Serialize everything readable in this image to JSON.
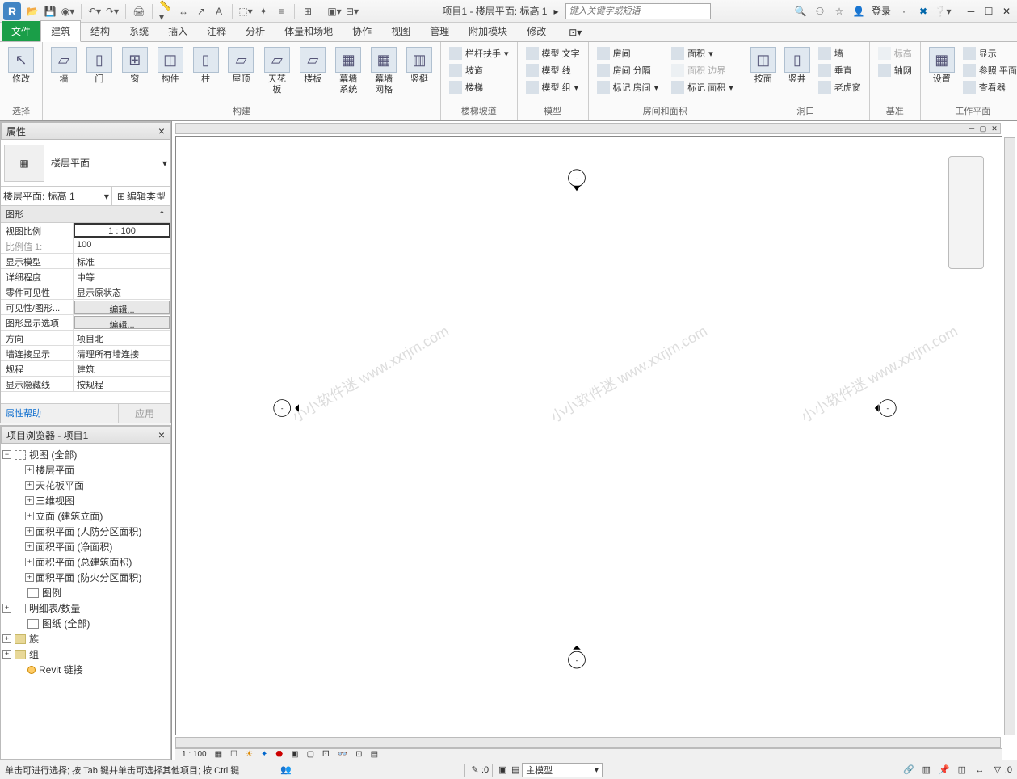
{
  "title": "项目1 - 楼层平面: 标高 1",
  "search_placeholder": "键入关键字或短语",
  "login_label": "登录",
  "revit_letter": "R",
  "ribbon_tabs": {
    "file": "文件",
    "arch": "建筑",
    "struct": "结构",
    "sys": "系统",
    "insert": "插入",
    "annot": "注释",
    "analyze": "分析",
    "mass": "体量和场地",
    "collab": "协作",
    "view": "视图",
    "manage": "管理",
    "addins": "附加模块",
    "modify": "修改"
  },
  "ribbon": {
    "select": {
      "modify": "修改",
      "group": "选择"
    },
    "build": {
      "wall": "墙",
      "door": "门",
      "window": "窗",
      "component": "构件",
      "column": "柱",
      "roof": "屋顶",
      "ceiling": "天花板",
      "floor": "楼板",
      "curtain_sys": "幕墙\n系统",
      "curtain_grid": "幕墙\n网格",
      "mullion": "竖梃",
      "group": "构建"
    },
    "circulation": {
      "railing": "栏杆扶手",
      "ramp": "坡道",
      "stair": "楼梯",
      "group": "楼梯坡道"
    },
    "model": {
      "model_text": "模型 文字",
      "model_line": "模型 线",
      "model_group": "模型 组",
      "group": "模型"
    },
    "room": {
      "room": "房间",
      "room_sep": "房间 分隔",
      "tag_room": "标记 房间",
      "area": "面积",
      "area_bound": "面积 边界",
      "tag_area": "标记 面积",
      "group": "房间和面积"
    },
    "opening": {
      "by_face": "按面",
      "vertical": "竖井",
      "wall": "墙",
      "vert": "垂直",
      "dormer": "老虎窗",
      "group": "洞口"
    },
    "datum": {
      "level": "标高",
      "grid": "轴网",
      "group": "基准"
    },
    "work_plane": {
      "set": "设置",
      "show": "显示",
      "ref": "参照 平面",
      "viewer": "查看器",
      "group": "工作平面"
    }
  },
  "props": {
    "panel_title": "属性",
    "type_name": "楼层平面",
    "instance": "楼层平面: 标高 1",
    "edit_type": "编辑类型",
    "category": "图形",
    "rows": [
      {
        "n": "视图比例",
        "v": "1 : 100",
        "boxed": true
      },
      {
        "n": "比例值 1:",
        "v": "100",
        "disabled": true
      },
      {
        "n": "显示模型",
        "v": "标准"
      },
      {
        "n": "详细程度",
        "v": "中等"
      },
      {
        "n": "零件可见性",
        "v": "显示原状态"
      },
      {
        "n": "可见性/图形...",
        "v": "编辑...",
        "btn": true
      },
      {
        "n": "图形显示选项",
        "v": "编辑...",
        "btn": true
      },
      {
        "n": "方向",
        "v": "项目北"
      },
      {
        "n": "墙连接显示",
        "v": "清理所有墙连接"
      },
      {
        "n": "规程",
        "v": "建筑"
      },
      {
        "n": "显示隐藏线",
        "v": "按规程"
      }
    ],
    "help": "属性帮助",
    "apply": "应用"
  },
  "browser": {
    "panel_title": "项目浏览器 - 项目1",
    "views_root": "视图 (全部)",
    "nodes": [
      "楼层平面",
      "天花板平面",
      "三维视图",
      "立面 (建筑立面)",
      "面积平面 (人防分区面积)",
      "面积平面 (净面积)",
      "面积平面 (总建筑面积)",
      "面积平面 (防火分区面积)"
    ],
    "legends": "图例",
    "schedules": "明细表/数量",
    "sheets": "图纸 (全部)",
    "families": "族",
    "groups": "组",
    "links": "Revit 链接"
  },
  "watermark": "小小软件迷 www.xxrjm.com",
  "view_ctrl": {
    "scale": "1 : 100"
  },
  "status": {
    "msg": "单击可进行选择; 按 Tab 键并单击可选择其他项目; 按 Ctrl 键",
    "count": ":0",
    "model": "主模型",
    "filter": ":0"
  }
}
